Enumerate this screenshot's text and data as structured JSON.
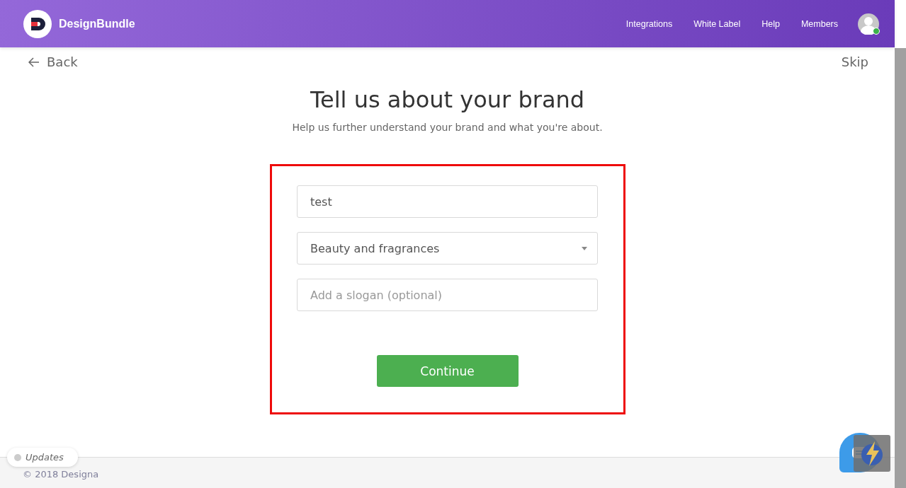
{
  "header": {
    "brand": "DesignBundle",
    "nav": [
      "Integrations",
      "White Label",
      "Help",
      "Members"
    ],
    "online": true
  },
  "back": "Back",
  "skip": "Skip",
  "title": "Tell us about your brand",
  "subtitle": "Help us further understand your brand and what you're about.",
  "form": {
    "name": {
      "value": "test"
    },
    "category": {
      "value": "Beauty and fragrances"
    },
    "slogan": {
      "placeholder": "Add a slogan (optional)"
    },
    "submit": "Continue"
  },
  "footer": {
    "copyright": "© 2018 Designa",
    "updates": "Updates"
  }
}
